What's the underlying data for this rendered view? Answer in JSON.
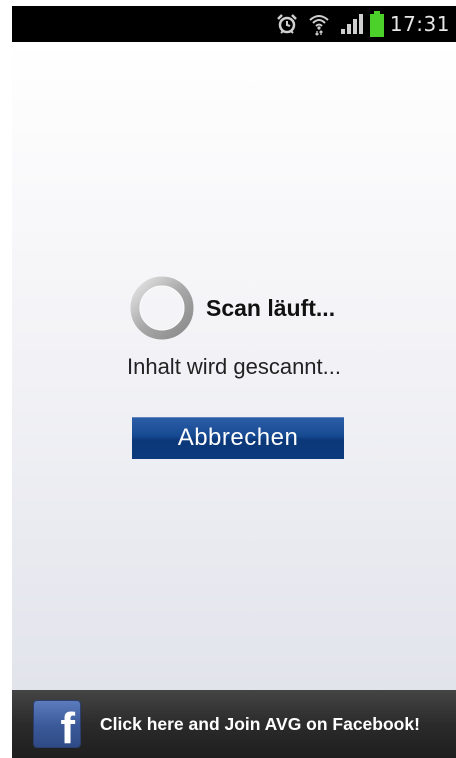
{
  "status_bar": {
    "time": "17:31",
    "icons": [
      "alarm-icon",
      "wifi-icon",
      "signal-icon",
      "battery-icon"
    ],
    "battery_color": "#4bd12a"
  },
  "scan": {
    "title": "Scan läuft...",
    "subtitle": "Inhalt wird gescannt...",
    "cancel_label": "Abbrechen"
  },
  "banner": {
    "logo_letter": "f",
    "text": "Click here and Join AVG on Facebook!",
    "logo_color": "#3b5998"
  },
  "colors": {
    "button_blue": "#164a91",
    "background": "#f2f2f6"
  }
}
